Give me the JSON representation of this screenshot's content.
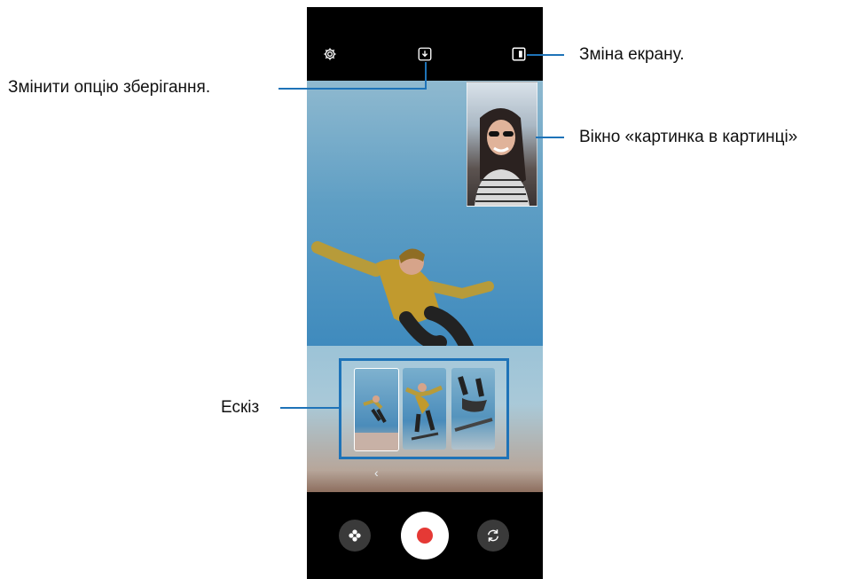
{
  "callouts": {
    "change_screen": "Зміна екрану.",
    "change_save_option": "Змінити опцію зберігання.",
    "pip_window": "Вікно «картинка в картинці»",
    "thumbnail": "Ескіз"
  },
  "icons": {
    "settings": "gear-icon",
    "save_option": "download-icon",
    "screen_switch": "screen-switch-icon",
    "effects": "flower-icon",
    "record": "record-icon",
    "switch_camera": "camera-switch-icon"
  },
  "colors": {
    "callout_line": "#1e73b8",
    "record": "#e53935"
  }
}
